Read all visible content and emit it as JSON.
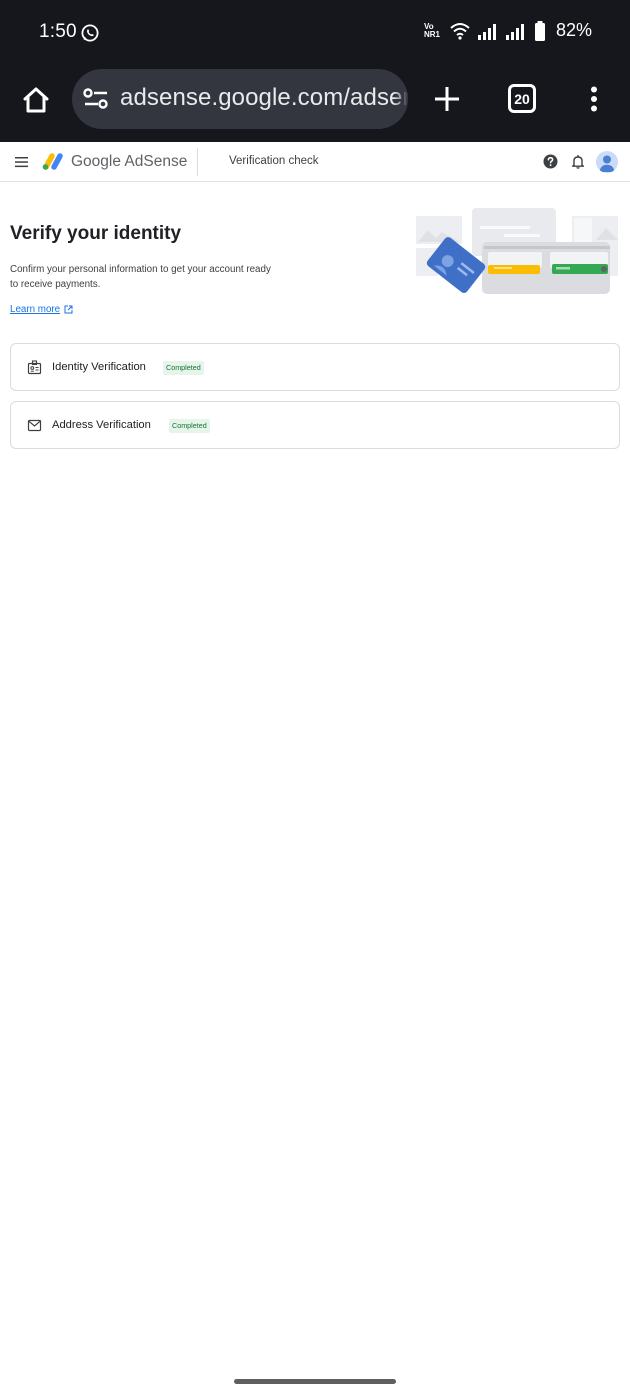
{
  "status_bar": {
    "time": "1:50",
    "volte_top": "Vo",
    "volte_bottom": "NR1",
    "battery": "82%",
    "icons": [
      "whatsapp-icon",
      "wifi-icon",
      "signal-icon",
      "signal-icon",
      "battery-icon"
    ]
  },
  "browser": {
    "url": "adsense.google.com/adsense",
    "tab_count": "20",
    "icons": [
      "home-icon",
      "site-settings-icon",
      "plus-icon",
      "more-vert-icon"
    ]
  },
  "app_header": {
    "logo_text": "Google AdSense",
    "title": "Verification check",
    "icons": [
      "menu-icon",
      "help-icon",
      "bell-icon",
      "avatar"
    ]
  },
  "main": {
    "title": "Verify your identity",
    "description": "Confirm your personal information to get your account ready to receive payments.",
    "learn_more": "Learn more",
    "cards": [
      {
        "label": "Identity Verification",
        "status": "Completed",
        "icon": "id-badge-icon"
      },
      {
        "label": "Address Verification",
        "status": "Completed",
        "icon": "mail-icon"
      }
    ]
  },
  "colors": {
    "chrome_bg": "#16171c",
    "url_pill": "#33363f",
    "link": "#1a73e8",
    "badge_text": "#137333",
    "badge_bg": "#e6f4ea"
  }
}
